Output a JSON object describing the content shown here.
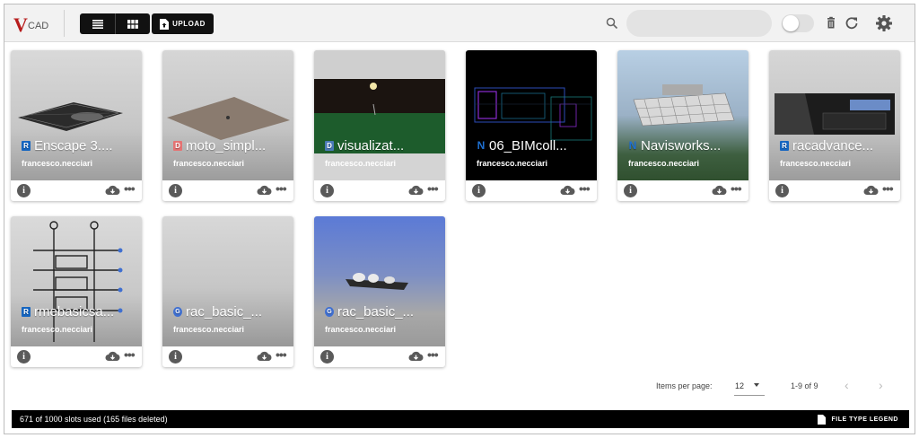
{
  "app": {
    "logo_mark": "V",
    "logo_text": "CAD",
    "brand_color": "#b71c1c"
  },
  "toolbar": {
    "upload_label": "UPLOAD",
    "search_placeholder": "",
    "list_view_icon": "list-icon",
    "grid_view_icon": "grid-icon",
    "toggle_on": false
  },
  "cards": [
    {
      "name": "Enscape 3....",
      "owner": "francesco.necciari",
      "file_type": "R",
      "file_type_color": "#1565c0"
    },
    {
      "name": "moto_simpl...",
      "owner": "francesco.necciari",
      "file_type": "D",
      "file_type_color": "#e57373"
    },
    {
      "name": "visualizat...",
      "owner": "francesco.necciari",
      "file_type": "D",
      "file_type_color": "#4a7ab8"
    },
    {
      "name": "06_BIMcoll...",
      "owner": "francesco.necciari",
      "file_type": "N",
      "file_type_color": "#1e6fd0"
    },
    {
      "name": "Navisworks...",
      "owner": "francesco.necciari",
      "file_type": "N",
      "file_type_color": "#1e6fd0"
    },
    {
      "name": "racadvance...",
      "owner": "francesco.necciari",
      "file_type": "R",
      "file_type_color": "#1565c0"
    },
    {
      "name": "rmebasicsa...",
      "owner": "francesco.necciari",
      "file_type": "R",
      "file_type_color": "#1565c0"
    },
    {
      "name": "rac_basic_...",
      "owner": "francesco.necciari",
      "file_type": "G",
      "file_type_color": "#3f6fd0"
    },
    {
      "name": "rac_basic_...",
      "owner": "francesco.necciari",
      "file_type": "G",
      "file_type_color": "#3f6fd0"
    }
  ],
  "pagination": {
    "items_per_page_label": "Items per page:",
    "items_per_page_value": "12",
    "range_label": "1-9 of 9"
  },
  "footer": {
    "status": "671 of 1000 slots used (165 files deleted)",
    "legend_label": "FILE TYPE LEGEND"
  }
}
